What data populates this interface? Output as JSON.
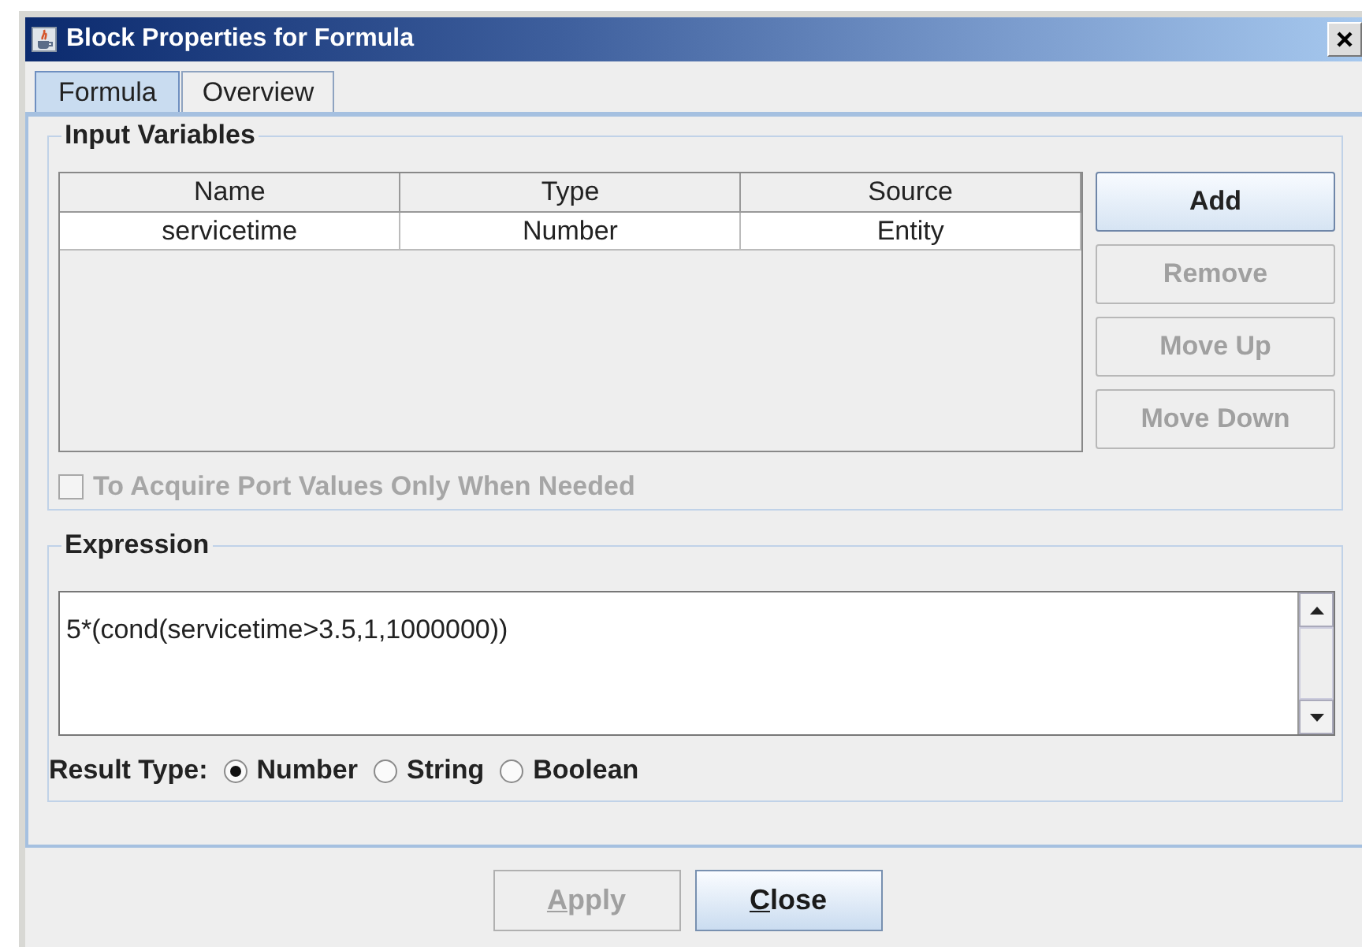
{
  "window": {
    "title": "Block Properties for Formula"
  },
  "tabs": [
    {
      "label": "Formula",
      "selected": true
    },
    {
      "label": "Overview",
      "selected": false
    }
  ],
  "input_variables": {
    "title": "Input Variables",
    "table": {
      "columns": [
        "Name",
        "Type",
        "Source"
      ],
      "rows": [
        [
          "servicetime",
          "Number",
          "Entity"
        ]
      ]
    },
    "buttons": [
      {
        "label": "Add",
        "disabled": false
      },
      {
        "label": "Remove",
        "disabled": true
      },
      {
        "label": "Move Up",
        "disabled": true
      },
      {
        "label": "Move Down",
        "disabled": true
      }
    ],
    "checkbox": {
      "label": "To Acquire Port Values Only When Needed",
      "checked": false,
      "disabled": true
    }
  },
  "expression": {
    "title": "Expression",
    "value": "5*(cond(servicetime>3.5,1,1000000))",
    "result_type": {
      "label": "Result Type:",
      "options": [
        {
          "label": "Number",
          "selected": true
        },
        {
          "label": "String",
          "selected": false
        },
        {
          "label": "Boolean",
          "selected": false
        }
      ]
    }
  },
  "footer_buttons": [
    {
      "mnemonic": "A",
      "rest": "pply",
      "disabled": true
    },
    {
      "mnemonic": "C",
      "rest": "lose",
      "disabled": false
    }
  ]
}
